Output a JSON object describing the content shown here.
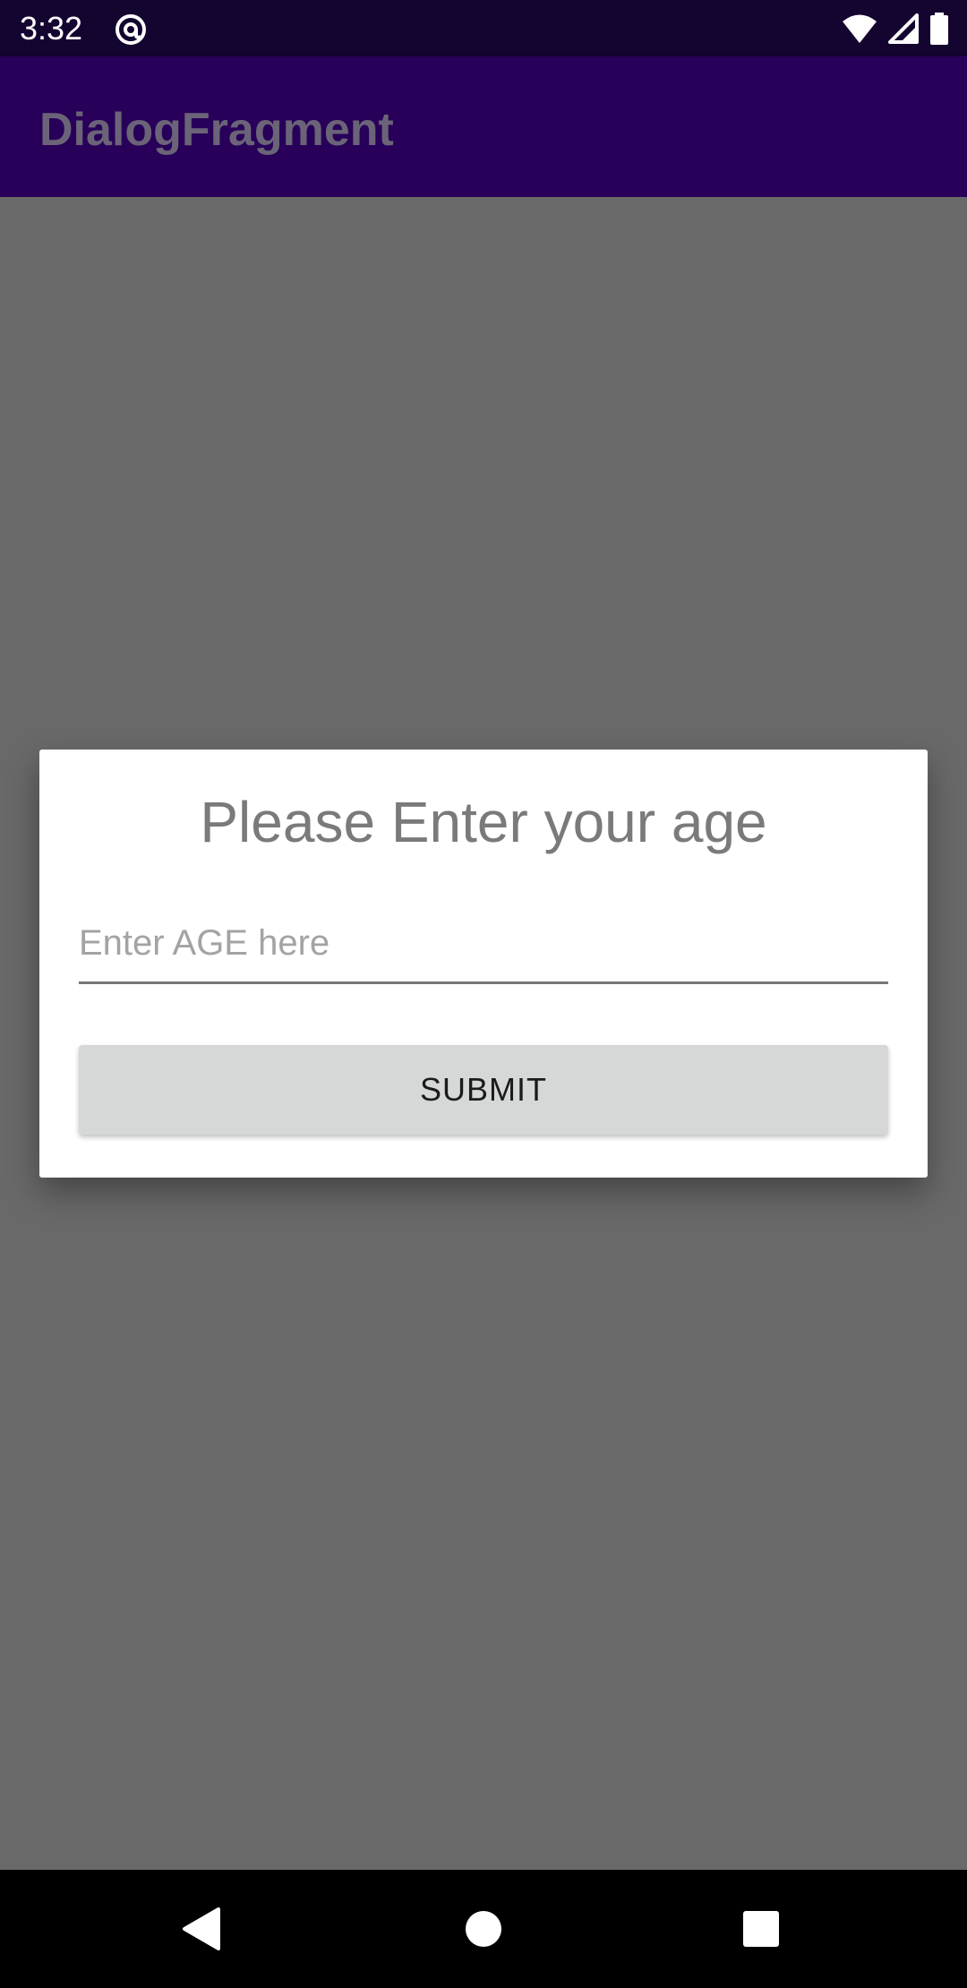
{
  "status_bar": {
    "time": "3:32",
    "icons": [
      "at-sign-icon",
      "wifi-icon",
      "cellular-signal-icon",
      "battery-icon"
    ]
  },
  "app_bar": {
    "title": "DialogFragment"
  },
  "dialog": {
    "title": "Please Enter your age",
    "age_input": {
      "placeholder": "Enter AGE here",
      "value": ""
    },
    "submit_label": "SUBMIT"
  },
  "nav_bar": {
    "icons": [
      "back-icon",
      "home-icon",
      "recents-icon"
    ]
  },
  "colors": {
    "status_bar_bg": "#140430",
    "app_bar_bg": "#28005a",
    "scrim": "#696969",
    "dialog_bg": "#ffffff",
    "button_bg": "#d6d7d7",
    "nav_bar_bg": "#000000"
  }
}
